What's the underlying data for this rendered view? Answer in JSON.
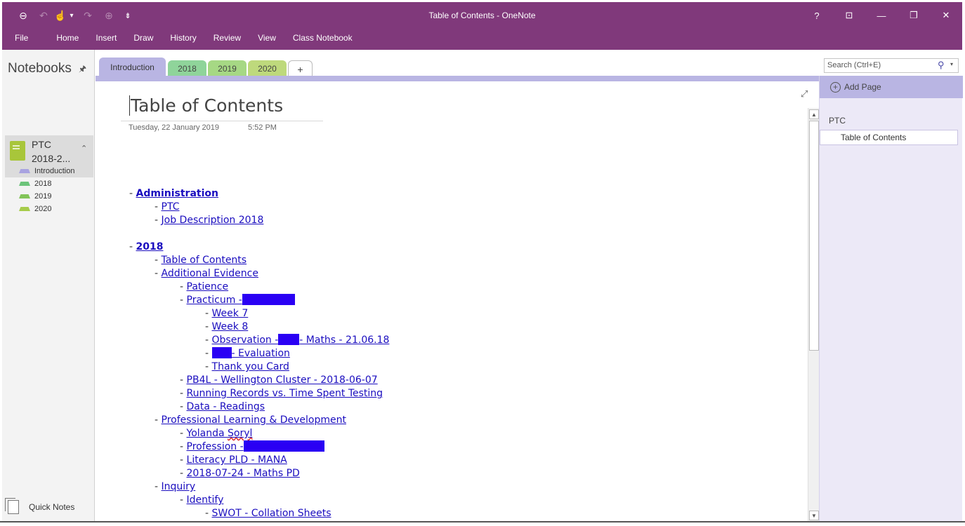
{
  "window": {
    "title": "Table of Contents - OneNote",
    "help": "?",
    "ribbon_display": "⊡",
    "minimize": "—",
    "restore": "❐",
    "close": "✕"
  },
  "quick_access": {
    "back": "⊖",
    "undo": "↶",
    "touch": "☝",
    "touch_dropdown": "▾",
    "redo": "↷",
    "forward": "⊕",
    "customize": "⇟"
  },
  "menu": [
    "File",
    "Home",
    "Insert",
    "Draw",
    "History",
    "Review",
    "View",
    "Class Notebook"
  ],
  "notebooks": {
    "header": "Notebooks",
    "pin": "🖈",
    "notebook_name": "PTC\n2018-2...",
    "collapse": "⌃",
    "sections": [
      {
        "label": "Introduction",
        "color": "#a8a3e0"
      },
      {
        "label": "2018",
        "color": "#6cc47a"
      },
      {
        "label": "2019",
        "color": "#82c458"
      },
      {
        "label": "2020",
        "color": "#a6cc4a"
      }
    ],
    "quick_notes": "Quick Notes"
  },
  "tabs": [
    {
      "label": "Introduction",
      "color": "#b9b5e3"
    },
    {
      "label": "2018",
      "color": "#8fd49a"
    },
    {
      "label": "2019",
      "color": "#a6d884"
    },
    {
      "label": "2020",
      "color": "#bed97c"
    },
    {
      "label": "+",
      "color": "#ffffff"
    }
  ],
  "page": {
    "title": "Table of Contents",
    "date": "Tuesday, 22 January 2019",
    "time": "5:52 PM",
    "expand_icon": "⤢",
    "scroll_up": "▲",
    "scroll_down": "▼"
  },
  "toc": [
    {
      "level": 0,
      "text": "Administration",
      "bold": true
    },
    {
      "level": 1,
      "text": "PTC"
    },
    {
      "level": 1,
      "text": "Job Description 2018"
    },
    {
      "level": -1,
      "text": ""
    },
    {
      "level": 0,
      "text": "2018",
      "bold": true
    },
    {
      "level": 1,
      "text": "Table of Contents"
    },
    {
      "level": 1,
      "text": "Additional Evidence"
    },
    {
      "level": 2,
      "text": "Patience"
    },
    {
      "level": 2,
      "text": "Practicum -",
      "redact_after": 75
    },
    {
      "level": 3,
      "text": "Week 7"
    },
    {
      "level": 3,
      "text": "Week 8"
    },
    {
      "level": 3,
      "text": "Observation -",
      "redact_after": 30,
      "text_after": "- Maths - 21.06.18"
    },
    {
      "level": 3,
      "text": "",
      "redact_after": 28,
      "text_after": "- Evaluation"
    },
    {
      "level": 3,
      "text": "Thank you Card"
    },
    {
      "level": 2,
      "text": "PB4L - Wellington Cluster - 2018-06-07"
    },
    {
      "level": 2,
      "text": "Running Records vs. Time Spent Testing"
    },
    {
      "level": 2,
      "text": "Data - Readings"
    },
    {
      "level": 1,
      "text": "Professional Learning & Development"
    },
    {
      "level": 2,
      "text": "Yolanda Soryl",
      "squiggle_word": "Soryl"
    },
    {
      "level": 2,
      "text": "Profession -",
      "redact_after": 115
    },
    {
      "level": 2,
      "text": "Literacy PLD - MANA"
    },
    {
      "level": 2,
      "text": "2018-07-24 - Maths PD"
    },
    {
      "level": 1,
      "text": "Inquiry"
    },
    {
      "level": 2,
      "text": "Identify"
    },
    {
      "level": 3,
      "text": "SWOT - Collation Sheets"
    }
  ],
  "right_pane": {
    "search_placeholder": "Search (Ctrl+E)",
    "search_icon": "⚲",
    "search_dropdown": "▾",
    "add_page": "Add Page",
    "section_name": "PTC",
    "page_title": "Table of Contents"
  }
}
